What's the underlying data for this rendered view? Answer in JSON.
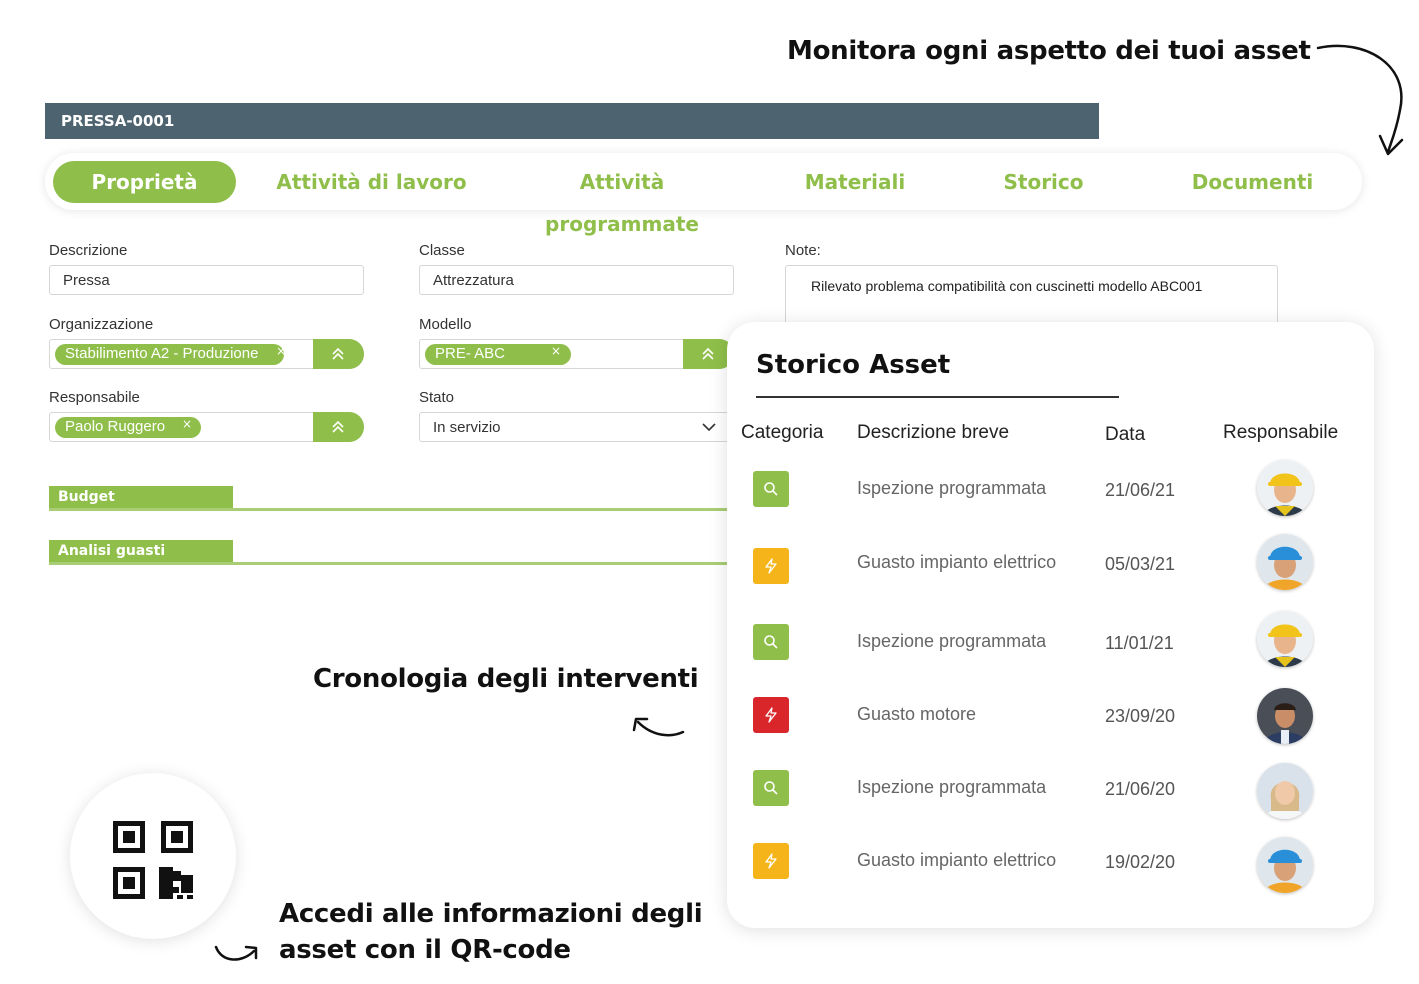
{
  "headlines": {
    "top": "Monitora ogni aspetto dei tuoi asset",
    "middle": "Cronologia degli interventi",
    "bottom_line1": "Accedi alle informazioni degli",
    "bottom_line2": "asset con il QR-code"
  },
  "asset": {
    "code": "PRESSA-0001"
  },
  "tabs": [
    {
      "label": "Proprietà",
      "active": true
    },
    {
      "label": "Attività di lavoro"
    },
    {
      "label": "Attività programmate"
    },
    {
      "label": "Materiali"
    },
    {
      "label": "Storico"
    },
    {
      "label": "Documenti"
    }
  ],
  "form": {
    "descrizione": {
      "label": "Descrizione",
      "value": "Pressa"
    },
    "classe": {
      "label": "Classe",
      "value": "Attrezzatura"
    },
    "note": {
      "label": "Note:",
      "value": "Rilevato problema compatibilità con cuscinetti modello ABC001"
    },
    "organizzazione": {
      "label": "Organizzazione",
      "chip": "Stabilimento A2 - Produzione",
      "chip_remove": "×"
    },
    "modello": {
      "label": "Modello",
      "chip": "PRE- ABC",
      "chip_remove": "×"
    },
    "responsabile": {
      "label": "Responsabile",
      "chip": "Paolo Ruggero",
      "chip_remove": "×"
    },
    "stato": {
      "label": "Stato",
      "value": "In servizio"
    }
  },
  "sections": {
    "budget": "Budget",
    "analisi_guasti": "Analisi guasti"
  },
  "storico": {
    "title": "Storico Asset",
    "columns": {
      "categoria": "Categoria",
      "descrizione": "Descrizione breve",
      "data": "Data",
      "responsabile": "Responsabile"
    },
    "rows": [
      {
        "category": "inspection",
        "icon": "search-icon",
        "color": "#8fbf4a",
        "description": "Ispezione programmata",
        "date": "21/06/21",
        "person": "female worker, yellow helmet"
      },
      {
        "category": "electrical-fault",
        "icon": "lightning-icon",
        "color": "#f5b51a",
        "description": "Guasto impianto elettrico",
        "date": "05/03/21",
        "person": "male worker, blue helmet"
      },
      {
        "category": "inspection",
        "icon": "search-icon",
        "color": "#8fbf4a",
        "description": "Ispezione programmata",
        "date": "11/01/21",
        "person": "female worker, yellow helmet"
      },
      {
        "category": "engine-fault",
        "icon": "lightning-icon",
        "color": "#d9262b",
        "description": "Guasto motore",
        "date": "23/09/20",
        "person": "male mechanic"
      },
      {
        "category": "inspection",
        "icon": "search-icon",
        "color": "#8fbf4a",
        "description": "Ispezione programmata",
        "date": "21/06/20",
        "person": "female smiling"
      },
      {
        "category": "electrical-fault",
        "icon": "lightning-icon",
        "color": "#f5b51a",
        "description": "Guasto impianto elettrico",
        "date": "19/02/20",
        "person": "male worker, blue helmet"
      }
    ]
  },
  "colors": {
    "accent_green": "#8fbf4a",
    "header_bar": "#4d6470",
    "warning_orange": "#f5b51a",
    "danger_red": "#d9262b"
  }
}
